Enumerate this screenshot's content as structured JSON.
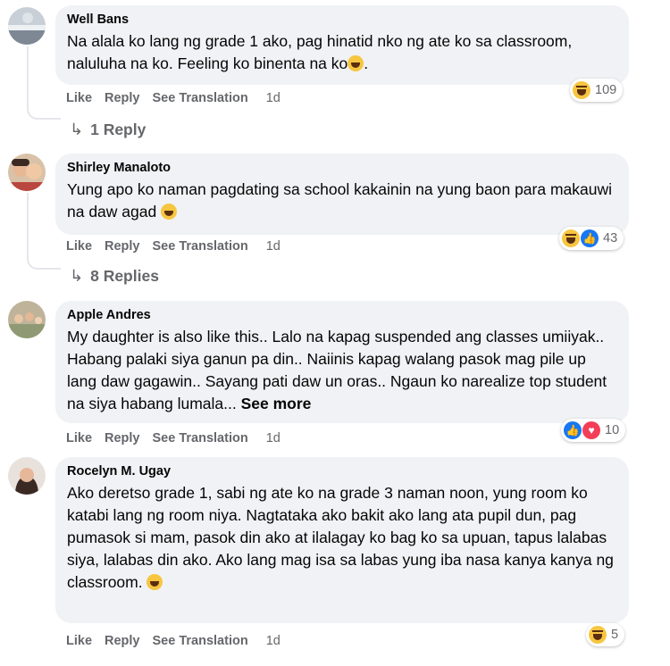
{
  "actions": {
    "like": "Like",
    "reply": "Reply",
    "see_translation": "See Translation"
  },
  "comments": [
    {
      "name": "Well Bans",
      "text": "Na alala ko lang ng grade 1 ako, pag hinatid nko ng ate ko sa classroom, naluluha na ko. Feeling ko binenta na ko",
      "emoji_after": "laughing-crying-emoji",
      "time": "1d",
      "reactions": [
        "haha"
      ],
      "reaction_count": "109",
      "replies": "1 Reply"
    },
    {
      "name": "Shirley Manaloto",
      "text": "Yung apo ko naman pagdating sa school kakainin na yung baon para makauwi na daw agad",
      "emoji_after": "rofl-emoji",
      "time": "1d",
      "reactions": [
        "haha",
        "like"
      ],
      "reaction_count": "43",
      "replies": "8 Replies"
    },
    {
      "name": "Apple Andres",
      "text": "My daughter is also like this.. Lalo na kapag suspended ang classes umiiyak.. Habang palaki siya ganun pa din.. Naiinis kapag walang pasok mag pile up lang daw gagawin.. Sayang pati daw un oras.. Ngaun ko narealize top student na siya habang lumala...",
      "see_more": "See more",
      "time": "1d",
      "reactions": [
        "like",
        "love"
      ],
      "reaction_count": "10"
    },
    {
      "name": "Rocelyn M. Ugay",
      "text": "Ako deretso grade 1, sabi ng ate ko na grade 3 naman noon, yung room ko katabi lang ng room niya. Nagtataka ako bakit ako lang ata pupil dun, pag pumasok si mam, pasok din ako at ilalagay ko bag ko sa upuan, tapus lalabas siya, lalabas din ako. Ako lang mag isa sa labas yung iba nasa kanya kanya ng classroom.",
      "emoji_after": "sad-emoji",
      "time": "1d",
      "reactions": [
        "haha"
      ],
      "reaction_count": "5"
    }
  ],
  "colors": {
    "bubble": "#f0f2f5",
    "meta": "#65676b",
    "like_blue": "#1877f2",
    "love_red": "#f33e58"
  }
}
